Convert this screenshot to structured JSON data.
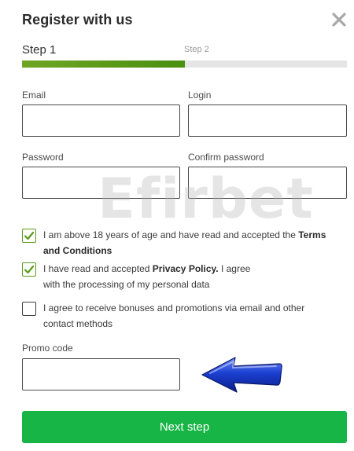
{
  "modal": {
    "title": "Register with us",
    "close_icon": "close-icon"
  },
  "steps": {
    "step1_label": "Step 1",
    "step2_label": "Step 2",
    "progress_fraction": 0.5,
    "progress_color": "#5a9a1a"
  },
  "form": {
    "email_label": "Email",
    "email_value": "",
    "login_label": "Login",
    "login_value": "",
    "password_label": "Password",
    "password_value": "",
    "confirm_password_label": "Confirm password",
    "confirm_password_value": "",
    "promo_label": "Promo code",
    "promo_value": ""
  },
  "watermark": "Efirbet",
  "checkboxes": [
    {
      "checked": true,
      "text_before": "I am above 18 years of age and have read and accepted the ",
      "link": "Terms and Conditions",
      "text_after": ""
    },
    {
      "checked": true,
      "text_before": "I have read and accepted ",
      "link": "Privacy Policy.",
      "text_after": " I agree with the processing of my personal data"
    },
    {
      "checked": false,
      "text_before": "I agree to receive bonuses and promotions via email and other contact methods",
      "link": "",
      "text_after": ""
    }
  ],
  "annotation": {
    "arrow_icon": "left-arrow-icon",
    "arrow_color": "#1b3fd0"
  },
  "actions": {
    "next_label": "Next step",
    "next_color": "#17b545"
  }
}
